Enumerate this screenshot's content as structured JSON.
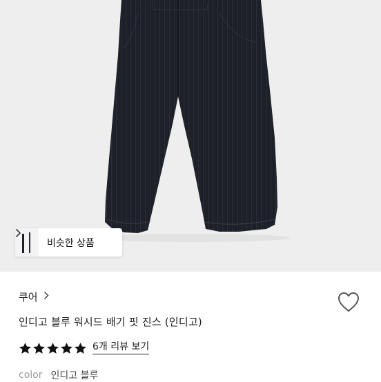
{
  "product": {
    "image_icon": "jeans-photo",
    "similar_button": {
      "label": "비슷한 상품",
      "icon": "chevron-right-icon"
    },
    "brand": {
      "name": "쿠어",
      "icon": "chevron-right-icon"
    },
    "title": "인디고 블루 워시드 배기 핏 진스 (인디고)",
    "rating": {
      "stars": 5,
      "max": 5,
      "review_link": "6개 리뷰 보기",
      "star_color": "#111111"
    },
    "color": {
      "key": "color",
      "value": "인디고 블루"
    },
    "wishlist_icon": "heart-outline-icon"
  },
  "colors": {
    "image_bg": "#eeeeee",
    "denim": "#1c1e26",
    "text": "#222222",
    "muted": "#9a9a9a"
  }
}
